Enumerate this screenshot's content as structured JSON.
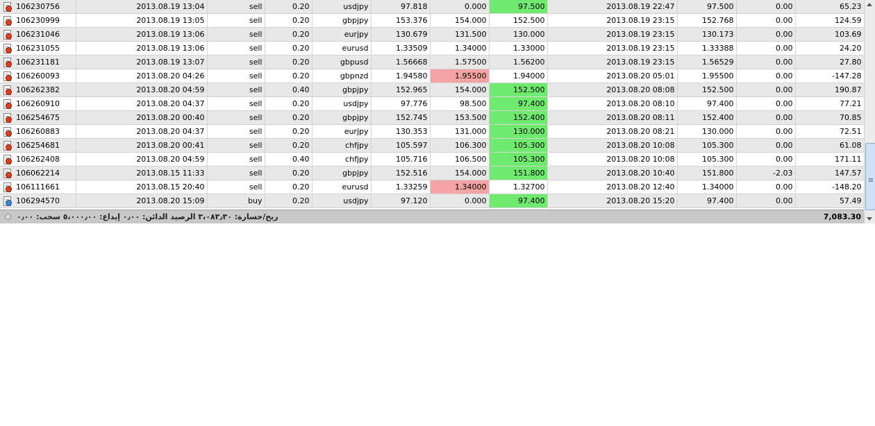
{
  "rows": [
    {
      "ticket": "106230756",
      "open_time": "2013.08.19 13:04",
      "type": "sell",
      "size": "0.20",
      "symbol": "usdjpy",
      "price": "97.818",
      "sl": "0.000",
      "tp": "97.500",
      "tp_hl": "green",
      "sl_hl": "",
      "close_time": "2013.08.19 22:47",
      "close_price": "97.500",
      "swap": "0.00",
      "profit": "65.23"
    },
    {
      "ticket": "106230999",
      "open_time": "2013.08.19 13:05",
      "type": "sell",
      "size": "0.20",
      "symbol": "gbpjpy",
      "price": "153.376",
      "sl": "154.000",
      "tp": "152.500",
      "tp_hl": "",
      "sl_hl": "",
      "close_time": "2013.08.19 23:15",
      "close_price": "152.768",
      "swap": "0.00",
      "profit": "124.59"
    },
    {
      "ticket": "106231046",
      "open_time": "2013.08.19 13:06",
      "type": "sell",
      "size": "0.20",
      "symbol": "eurjpy",
      "price": "130.679",
      "sl": "131.500",
      "tp": "130.000",
      "tp_hl": "",
      "sl_hl": "",
      "close_time": "2013.08.19 23:15",
      "close_price": "130.173",
      "swap": "0.00",
      "profit": "103.69"
    },
    {
      "ticket": "106231055",
      "open_time": "2013.08.19 13:06",
      "type": "sell",
      "size": "0.20",
      "symbol": "eurusd",
      "price": "1.33509",
      "sl": "1.34000",
      "tp": "1.33000",
      "tp_hl": "",
      "sl_hl": "",
      "close_time": "2013.08.19 23:15",
      "close_price": "1.33388",
      "swap": "0.00",
      "profit": "24.20"
    },
    {
      "ticket": "106231181",
      "open_time": "2013.08.19 13:07",
      "type": "sell",
      "size": "0.20",
      "symbol": "gbpusd",
      "price": "1.56668",
      "sl": "1.57500",
      "tp": "1.56200",
      "tp_hl": "",
      "sl_hl": "",
      "close_time": "2013.08.19 23:15",
      "close_price": "1.56529",
      "swap": "0.00",
      "profit": "27.80"
    },
    {
      "ticket": "106260093",
      "open_time": "2013.08.20 04:26",
      "type": "sell",
      "size": "0.20",
      "symbol": "gbpnzd",
      "price": "1.94580",
      "sl": "1.95500",
      "tp": "1.94000",
      "tp_hl": "",
      "sl_hl": "red",
      "close_time": "2013.08.20 05:01",
      "close_price": "1.95500",
      "swap": "0.00",
      "profit": "-147.28"
    },
    {
      "ticket": "106262382",
      "open_time": "2013.08.20 04:59",
      "type": "sell",
      "size": "0.40",
      "symbol": "gbpjpy",
      "price": "152.965",
      "sl": "154.000",
      "tp": "152.500",
      "tp_hl": "green",
      "sl_hl": "",
      "close_time": "2013.08.20 08:08",
      "close_price": "152.500",
      "swap": "0.00",
      "profit": "190.87"
    },
    {
      "ticket": "106260910",
      "open_time": "2013.08.20 04:37",
      "type": "sell",
      "size": "0.20",
      "symbol": "usdjpy",
      "price": "97.776",
      "sl": "98.500",
      "tp": "97.400",
      "tp_hl": "green",
      "sl_hl": "",
      "close_time": "2013.08.20 08:10",
      "close_price": "97.400",
      "swap": "0.00",
      "profit": "77.21"
    },
    {
      "ticket": "106254675",
      "open_time": "2013.08.20 00:40",
      "type": "sell",
      "size": "0.20",
      "symbol": "gbpjpy",
      "price": "152.745",
      "sl": "153.500",
      "tp": "152.400",
      "tp_hl": "green",
      "sl_hl": "",
      "close_time": "2013.08.20 08:11",
      "close_price": "152.400",
      "swap": "0.00",
      "profit": "70.85"
    },
    {
      "ticket": "106260883",
      "open_time": "2013.08.20 04:37",
      "type": "sell",
      "size": "0.20",
      "symbol": "eurjpy",
      "price": "130.353",
      "sl": "131.000",
      "tp": "130.000",
      "tp_hl": "green",
      "sl_hl": "",
      "close_time": "2013.08.20 08:21",
      "close_price": "130.000",
      "swap": "0.00",
      "profit": "72.51"
    },
    {
      "ticket": "106254681",
      "open_time": "2013.08.20 00:41",
      "type": "sell",
      "size": "0.20",
      "symbol": "chfjpy",
      "price": "105.597",
      "sl": "106.300",
      "tp": "105.300",
      "tp_hl": "green",
      "sl_hl": "",
      "close_time": "2013.08.20 10:08",
      "close_price": "105.300",
      "swap": "0.00",
      "profit": "61.08"
    },
    {
      "ticket": "106262408",
      "open_time": "2013.08.20 04:59",
      "type": "sell",
      "size": "0.40",
      "symbol": "chfjpy",
      "price": "105.716",
      "sl": "106.500",
      "tp": "105.300",
      "tp_hl": "green",
      "sl_hl": "",
      "close_time": "2013.08.20 10:08",
      "close_price": "105.300",
      "swap": "0.00",
      "profit": "171.11"
    },
    {
      "ticket": "106062214",
      "open_time": "2013.08.15 11:33",
      "type": "sell",
      "size": "0.20",
      "symbol": "gbpjpy",
      "price": "152.516",
      "sl": "154.000",
      "tp": "151.800",
      "tp_hl": "green",
      "sl_hl": "",
      "close_time": "2013.08.20 10:40",
      "close_price": "151.800",
      "swap": "-2.03",
      "profit": "147.57"
    },
    {
      "ticket": "106111661",
      "open_time": "2013.08.15 20:40",
      "type": "sell",
      "size": "0.20",
      "symbol": "eurusd",
      "price": "1.33259",
      "sl": "1.34000",
      "tp": "1.32700",
      "tp_hl": "",
      "sl_hl": "red",
      "close_time": "2013.08.20 12:40",
      "close_price": "1.34000",
      "swap": "0.00",
      "profit": "-148.20"
    },
    {
      "ticket": "106294570",
      "open_time": "2013.08.20 15:09",
      "type": "buy",
      "size": "0.20",
      "symbol": "usdjpy",
      "price": "97.120",
      "sl": "0.000",
      "tp": "97.400",
      "tp_hl": "green",
      "sl_hl": "",
      "close_time": "2013.08.20 15:20",
      "close_price": "97.400",
      "swap": "0.00",
      "profit": "57.49"
    }
  ],
  "summary": {
    "text": "ربح/خسارة: ٣،٠٨٣٫٣٠  الرصيد الدائن: ٠٫٠٠  إيداع: ٥،٠٠٠٫٠٠  سحب: ٠٫٠٠",
    "total": "7,083.30"
  },
  "colors": {
    "take_profit_hit": "#6fea6f",
    "stop_loss_hit": "#f4a4a4",
    "odd_row": "#e8e8e8",
    "even_row": "#ffffff"
  },
  "icons": {
    "sell": "sell-order-icon",
    "buy": "buy-order-icon"
  }
}
